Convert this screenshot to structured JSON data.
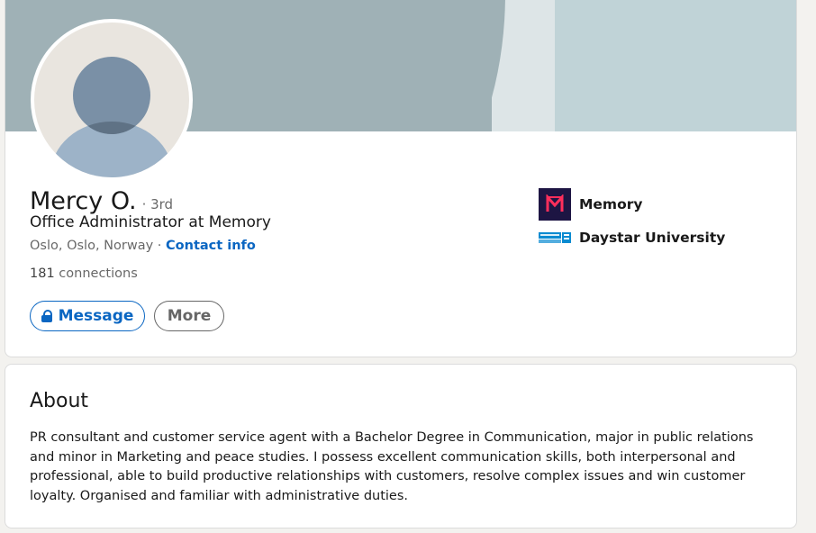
{
  "profile": {
    "name": "Mercy O.",
    "degree": "· 3rd",
    "headline": "Office Administrator at Memory",
    "location": "Oslo, Oslo, Norway",
    "separator": " · ",
    "contact_info_label": "Contact info",
    "connections_count": "181",
    "connections_label": " connections",
    "actions": {
      "message_label": "Message",
      "more_label": "More"
    },
    "organizations": [
      {
        "name": "Memory",
        "logo": "memory-logo"
      },
      {
        "name": "Daystar University",
        "logo": "daystar-university-logo"
      }
    ]
  },
  "about": {
    "title": "About",
    "text": "PR consultant and customer service agent with a Bachelor Degree in Communication, major in public relations and minor in Marketing and peace studies. I possess excellent communication skills, both interpersonal and professional, able to build productive relationships with customers, resolve complex issues and win customer loyalty. Organised and familiar with administrative duties."
  },
  "colors": {
    "accent": "#0a66c2",
    "banner": "#9fb1b6",
    "banner_light": "#c0d3d7",
    "memory_brand": "#1d1543",
    "memory_mark": "#ff2e5b",
    "daystar_brand": "#0b8bd1"
  }
}
